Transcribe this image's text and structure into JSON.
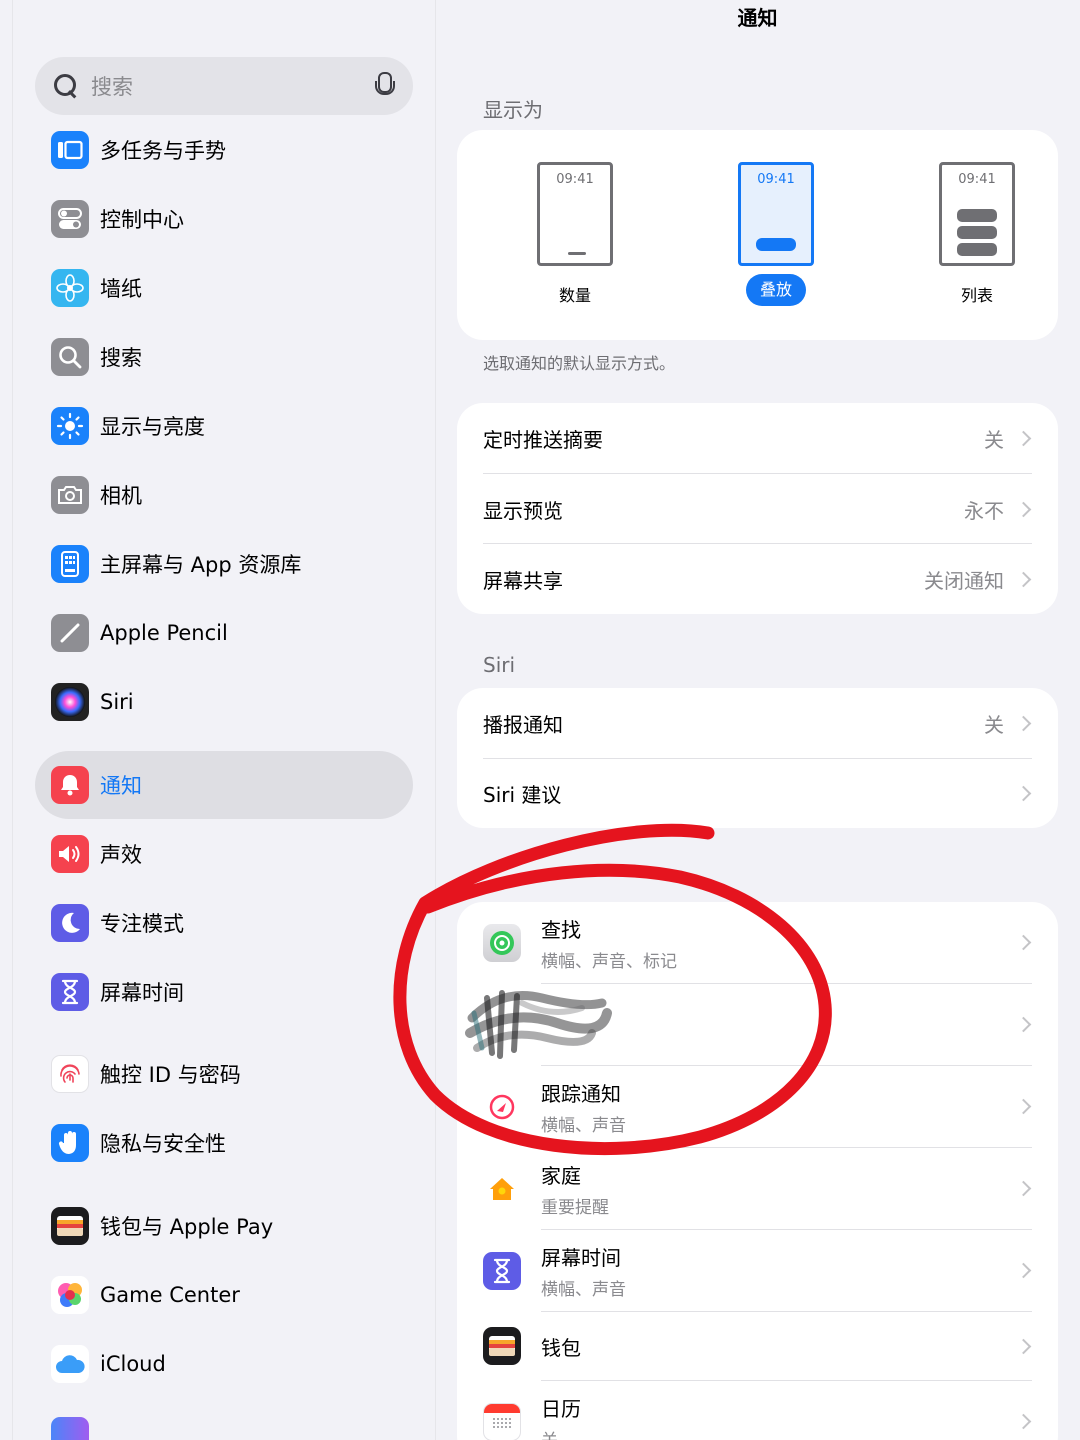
{
  "sidebar": {
    "search_placeholder": "搜索",
    "items": [
      {
        "label": "多任务与手势",
        "icon": "multitasking-icon",
        "color": "#1a82fb"
      },
      {
        "label": "控制中心",
        "icon": "toggles-icon",
        "color": "#8e8e93"
      },
      {
        "label": "墙纸",
        "icon": "flower-icon",
        "color": "#35b6f0"
      },
      {
        "label": "搜索",
        "icon": "search-icon",
        "color": "#8e8e93"
      },
      {
        "label": "显示与亮度",
        "icon": "sun-icon",
        "color": "#1a82fb"
      },
      {
        "label": "相机",
        "icon": "camera-icon",
        "color": "#8e8e93"
      },
      {
        "label": "主屏幕与 App 资源库",
        "icon": "home-screen-icon",
        "color": "#1a82fb"
      },
      {
        "label": "Apple Pencil",
        "icon": "pencil-icon",
        "color": "#8e8e93"
      },
      {
        "label": "Siri",
        "icon": "siri-icon",
        "color": "#222222"
      },
      {
        "label": "通知",
        "icon": "bell-icon",
        "color": "#f5424e"
      },
      {
        "label": "声效",
        "icon": "speaker-icon",
        "color": "#f5424e"
      },
      {
        "label": "专注模式",
        "icon": "moon-icon",
        "color": "#5e5ce6"
      },
      {
        "label": "屏幕时间",
        "icon": "hourglass-icon",
        "color": "#5e5ce6"
      },
      {
        "label": "触控 ID 与密码",
        "icon": "fingerprint-icon",
        "color": "#ffffff"
      },
      {
        "label": "隐私与安全性",
        "icon": "hand-icon",
        "color": "#1a82fb"
      },
      {
        "label": "钱包与 Apple Pay",
        "icon": "wallet-icon",
        "color": "#1c1c1e"
      },
      {
        "label": "Game Center",
        "icon": "game-center-icon",
        "color": "#ffffff"
      },
      {
        "label": "iCloud",
        "icon": "cloud-icon",
        "color": "#ffffff"
      }
    ]
  },
  "main": {
    "title": "通知",
    "display_as": {
      "header": "显示为",
      "time": "09:41",
      "options": [
        {
          "label": "数量",
          "selected": false
        },
        {
          "label": "叠放",
          "selected": true
        },
        {
          "label": "列表",
          "selected": false
        }
      ],
      "footnote": "选取通知的默认显示方式。"
    },
    "general_rows": [
      {
        "label": "定时推送摘要",
        "value": "关"
      },
      {
        "label": "显示预览",
        "value": "永不"
      },
      {
        "label": "屏幕共享",
        "value": "关闭通知"
      }
    ],
    "siri": {
      "header": "Siri",
      "rows": [
        {
          "label": "播报通知",
          "value": "关"
        },
        {
          "label": "Siri 建议",
          "value": ""
        }
      ]
    },
    "apps": [
      {
        "name": "查找",
        "detail": "横幅、声音、标记",
        "icon": "find-my-icon"
      },
      {
        "name": "",
        "detail": "",
        "icon": "redacted-icon"
      },
      {
        "name": "跟踪通知",
        "detail": "横幅、声音",
        "icon": "tracking-icon"
      },
      {
        "name": "家庭",
        "detail": "重要提醒",
        "icon": "home-icon"
      },
      {
        "name": "屏幕时间",
        "detail": "横幅、声音",
        "icon": "hourglass-icon"
      },
      {
        "name": "钱包",
        "detail": "",
        "icon": "wallet-icon"
      },
      {
        "name": "日历",
        "detail": "关",
        "icon": "calendar-icon"
      }
    ]
  },
  "annotation_color": "#e5141e",
  "accent": "#1478f5"
}
